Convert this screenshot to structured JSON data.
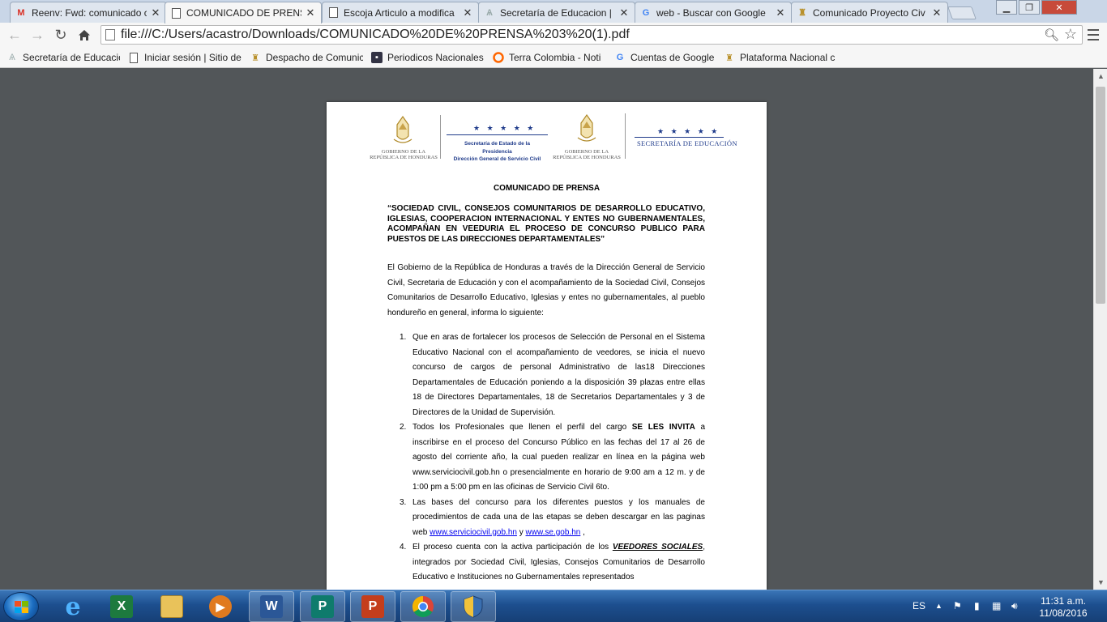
{
  "tabs": [
    {
      "label": "Reenv: Fwd: comunicado c",
      "icon": "gmail-icon",
      "active": false
    },
    {
      "label": "COMUNICADO DE PRENS",
      "icon": "document-icon",
      "active": true
    },
    {
      "label": "Escoja Articulo a modifica",
      "icon": "document-icon",
      "active": false
    },
    {
      "label": "Secretaría de Educacion | I",
      "icon": "education-icon",
      "active": false
    },
    {
      "label": "web - Buscar con Google",
      "icon": "google-icon",
      "active": false
    },
    {
      "label": "Comunicado Proyecto Civ",
      "icon": "crest-icon",
      "active": false
    }
  ],
  "address_bar": {
    "url": "file:///C:/Users/acastro/Downloads/COMUNICADO%20DE%20PRENSA%203%20(1).pdf"
  },
  "bookmarks": [
    {
      "label": "Secretaría de Educacio",
      "icon": "education-icon"
    },
    {
      "label": "Iniciar sesión | Sitio de",
      "icon": "page-icon"
    },
    {
      "label": "Despacho de Comunic",
      "icon": "crest-icon"
    },
    {
      "label": "Periodicos Nacionales",
      "icon": "news-icon"
    },
    {
      "label": "Terra Colombia - Noti",
      "icon": "terra-icon"
    },
    {
      "label": "Cuentas de Google",
      "icon": "google-icon"
    },
    {
      "label": "Plataforma Nacional c",
      "icon": "crest-icon"
    }
  ],
  "document": {
    "header": {
      "gov_left": "GOBIERNO DE LA\nREPÚBLICA DE HONDURAS",
      "sec_lines": [
        "Secretaría de Estado de la",
        "Presidencia",
        "Dirección General de Servicio Civil"
      ],
      "gov_right": "GOBIERNO DE LA\nREPÚBLICA DE HONDURAS",
      "se_label": "SECRETARÍA DE EDUCACIÓN",
      "stars": "★ ★ ★ ★ ★"
    },
    "title": "COMUNICADO DE PRENSA",
    "subtitle": "“SOCIEDAD CIVIL, CONSEJOS COMUNITARIOS DE DESARROLLO EDUCATIVO, IGLESIAS, COOPERACION INTERNACIONAL Y ENTES NO GUBERNAMENTALES, ACOMPAÑAN  EN VEEDURIA EL PROCESO DE CONCURSO PUBLICO PARA PUESTOS DE LAS DIRECCIONES DEPARTAMENTALES”",
    "intro": "El Gobierno de la República de Honduras a través de la Dirección General de Servicio Civil, Secretaria de Educación y con el acompañamiento de la Sociedad Civil, Consejos Comunitarios de Desarrollo Educativo, Iglesias y entes no gubernamentales, al pueblo hondureño en general, informa lo siguiente:",
    "items": [
      {
        "num": "1.",
        "text": "Que en aras de fortalecer los procesos de Selección de Personal en el Sistema Educativo Nacional con el acompañamiento de veedores, se inicia el nuevo concurso de cargos de personal Administrativo de las18 Direcciones Departamentales de Educación poniendo a la disposición 39 plazas entre ellas 18 de Directores Departamentales, 18 de Secretarios Departamentales y 3 de Directores de la Unidad de Supervisión."
      },
      {
        "num": "2.",
        "pre": "Todos los Profesionales que llenen el perfil del cargo ",
        "bold": "SE LES INVITA",
        "post": " a inscribirse en el proceso del Concurso Público en las fechas del 17 al 26 de agosto del corriente año, la cual pueden realizar en línea en la página web www.serviciocivil.gob.hn o presencialmente en horario de 9:00 am a 12 m. y de 1:00 pm a 5:00 pm en las oficinas de Servicio Civil 6to."
      },
      {
        "num": "3.",
        "pre": "Las bases del concurso para los diferentes puestos y los manuales de procedimientos de cada una de las etapas se deben descargar en las paginas web ",
        "link1": "www.serviciocivil.gob.hn",
        "mid": " y ",
        "link2": "www.se.gob.hn",
        "post": " ,"
      },
      {
        "num": "4.",
        "pre": "El proceso cuenta con la activa participación de los ",
        "em": "VEEDORES SOCIALES",
        "post": ", integrados por Sociedad Civil, Iglesias, Consejos Comunitarios de Desarrollo Educativo e Instituciones no Gubernamentales representados"
      }
    ]
  },
  "taskbar": {
    "language": "ES",
    "time": "11:31 a.m.",
    "date": "11/08/2016",
    "apps": [
      {
        "name": "internet-explorer",
        "glyph": "e",
        "color": "#1e88e5"
      },
      {
        "name": "excel",
        "glyph": "X",
        "color": "#1d7a3e"
      },
      {
        "name": "file-explorer",
        "glyph": "",
        "color": "#e0b240"
      },
      {
        "name": "media-player",
        "glyph": "▶",
        "color": "#e07a1f"
      },
      {
        "name": "word",
        "glyph": "W",
        "color": "#2b5797"
      },
      {
        "name": "publisher",
        "glyph": "P",
        "color": "#0f7b6c"
      },
      {
        "name": "powerpoint",
        "glyph": "P",
        "color": "#c43e1c"
      },
      {
        "name": "chrome",
        "glyph": "",
        "color": "#ffffff"
      },
      {
        "name": "security-shield",
        "glyph": "",
        "color": "#3a6fb0"
      }
    ]
  },
  "colors": {
    "viewer_bg": "#525659",
    "accent_blue": "#1e3a8a",
    "link": "#0000ee"
  }
}
